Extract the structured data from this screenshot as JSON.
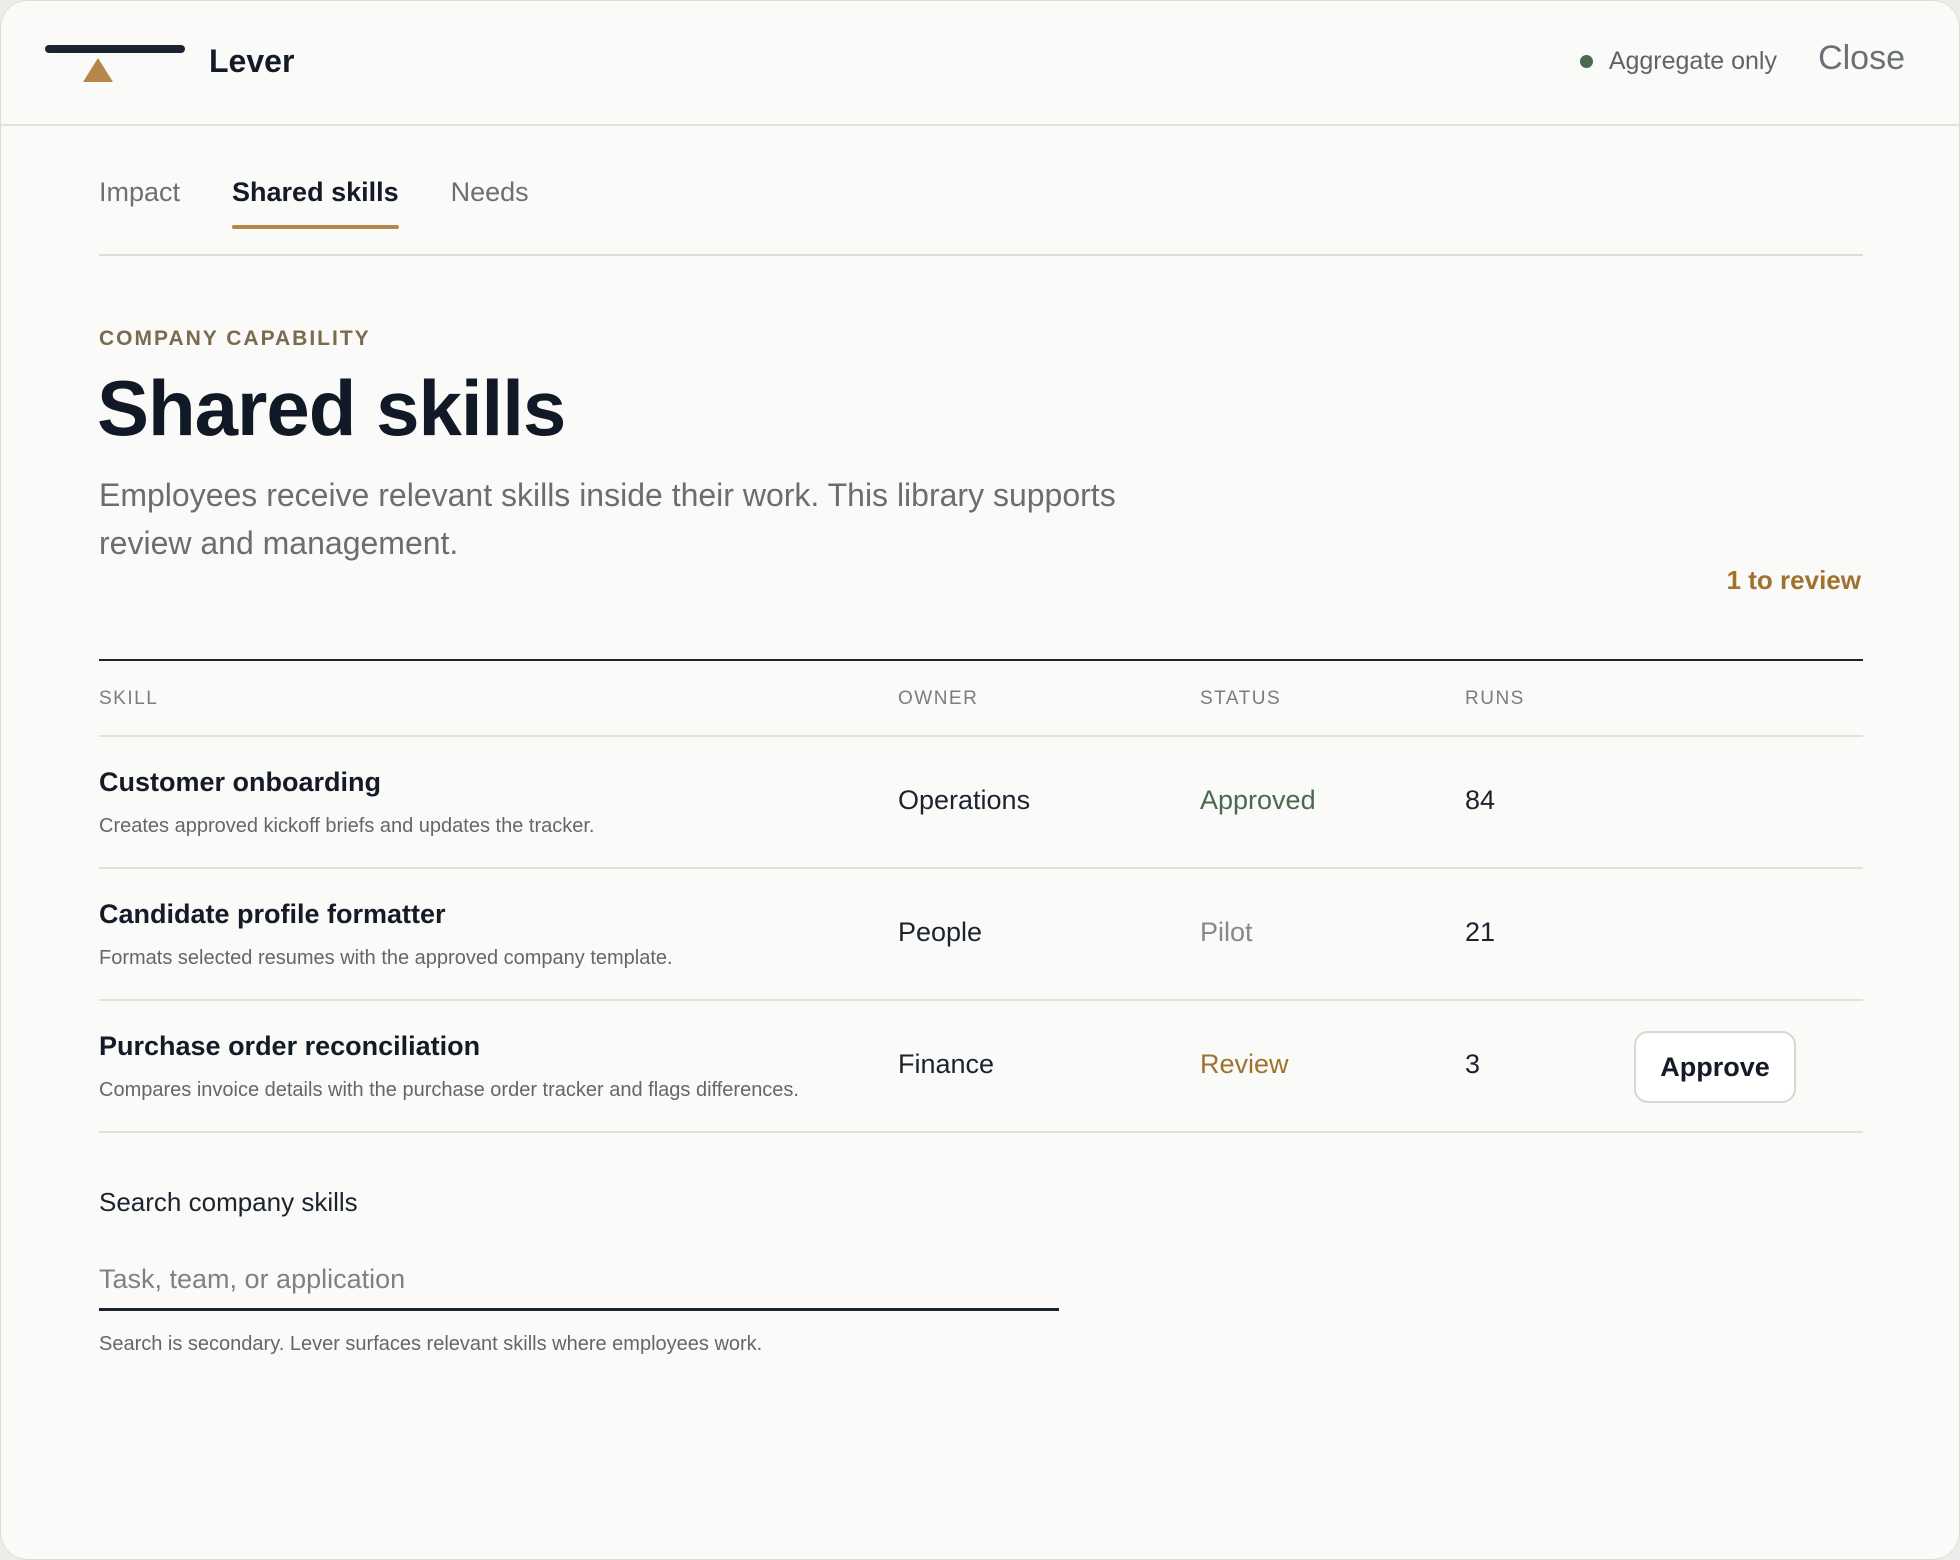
{
  "header": {
    "app_name": "Lever",
    "privacy_label": "Aggregate only",
    "close_label": "Close"
  },
  "tabs": [
    {
      "label": "Impact",
      "active": false
    },
    {
      "label": "Shared skills",
      "active": true
    },
    {
      "label": "Needs",
      "active": false
    }
  ],
  "intro": {
    "eyebrow": "COMPANY CAPABILITY",
    "title": "Shared skills",
    "description": "Employees receive relevant skills inside their work. This library supports review and management.",
    "review_count": "1 to review"
  },
  "table": {
    "columns": [
      "SKILL",
      "OWNER",
      "STATUS",
      "RUNS"
    ],
    "rows": [
      {
        "name": "Customer onboarding",
        "description": "Creates approved kickoff briefs and updates the tracker.",
        "owner": "Operations",
        "status": "Approved",
        "runs": "84"
      },
      {
        "name": "Candidate profile formatter",
        "description": "Formats selected resumes with the approved company template.",
        "owner": "People",
        "status": "Pilot",
        "runs": "21"
      },
      {
        "name": "Purchase order reconciliation",
        "description": "Compares invoice details with the purchase order tracker and flags differences.",
        "owner": "Finance",
        "status": "Review",
        "runs": "3",
        "action_label": "Approve"
      }
    ]
  },
  "search": {
    "label": "Search company skills",
    "value": "",
    "placeholder": "Task, team, or application",
    "hint": "Search is secondary. Lever surfaces relevant skills where employees work."
  },
  "colors": {
    "accent": "#b5874a",
    "approved": "#4a6a50",
    "review": "#a0722f",
    "ink": "#141b26"
  }
}
